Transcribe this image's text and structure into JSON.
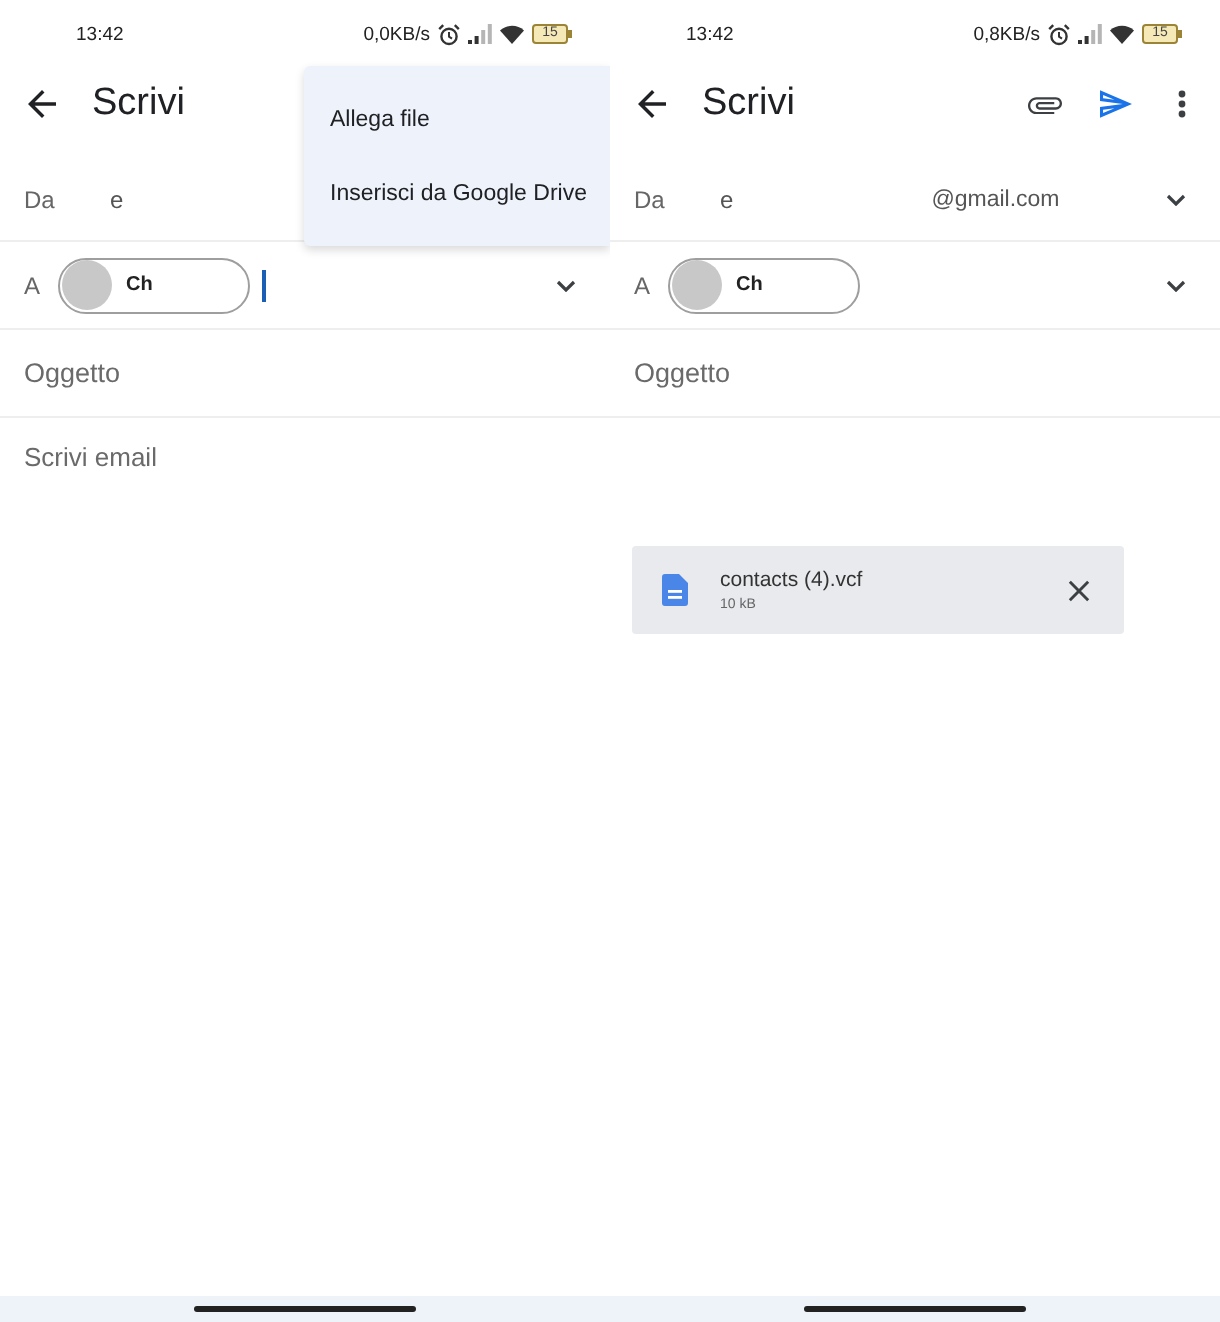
{
  "screens": [
    {
      "status_bar": {
        "time": "13:42",
        "net_speed": "0,0KB/s",
        "battery": "15"
      },
      "app_bar": {
        "title": "Scrivi"
      },
      "from": {
        "label": "Da",
        "name": "e"
      },
      "to": {
        "label": "A",
        "chips": [
          {
            "text": "Ch"
          }
        ],
        "focused": true,
        "expandable": true
      },
      "subject": {
        "placeholder": "Oggetto"
      },
      "body": {
        "placeholder": "Scrivi email"
      },
      "menu": {
        "items": [
          "Allega file",
          "Inserisci da Google Drive"
        ]
      }
    },
    {
      "status_bar": {
        "time": "13:42",
        "net_speed": "0,8KB/s",
        "battery": "15"
      },
      "app_bar": {
        "title": "Scrivi",
        "actions": [
          {
            "kind": "attach"
          },
          {
            "kind": "send"
          },
          {
            "kind": "more"
          }
        ]
      },
      "from": {
        "label": "Da",
        "name": "e",
        "address": "@gmail.com",
        "expandable": true
      },
      "to": {
        "label": "A",
        "chips": [
          {
            "text": "Ch"
          }
        ],
        "focused": false,
        "expandable": true
      },
      "subject": {
        "placeholder": "Oggetto"
      },
      "body": {
        "attachments": [
          {
            "name": "contacts (4).vcf",
            "size": "10 kB"
          }
        ]
      }
    }
  ]
}
